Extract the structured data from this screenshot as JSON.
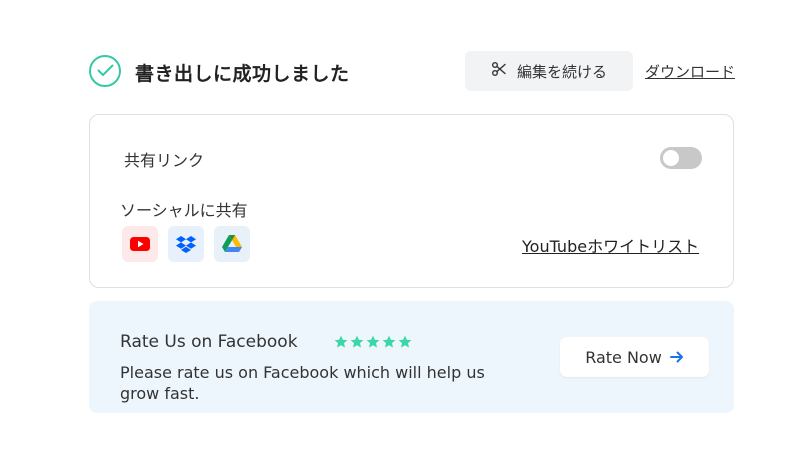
{
  "header": {
    "title": "書き出しに成功しました",
    "edit_button_label": "編集を続ける",
    "download_link": "ダウンロード"
  },
  "share": {
    "title": "共有リンク",
    "toggle_on": false,
    "social_label": "ソーシャルに共有",
    "icons": [
      "youtube-icon",
      "dropbox-icon",
      "google-drive-icon"
    ],
    "whitelist_link": "YouTubeホワイトリスト"
  },
  "rate": {
    "title": "Rate Us on Facebook",
    "stars": 5,
    "description": "Please rate us on Facebook which will help us grow fast.",
    "button_label": "Rate Now"
  },
  "colors": {
    "accent_green": "#35c9a6",
    "star_color": "#3ed6a8",
    "arrow_blue": "#1a73e8",
    "youtube_red": "#ff0000",
    "dropbox_blue": "#0061fe"
  }
}
